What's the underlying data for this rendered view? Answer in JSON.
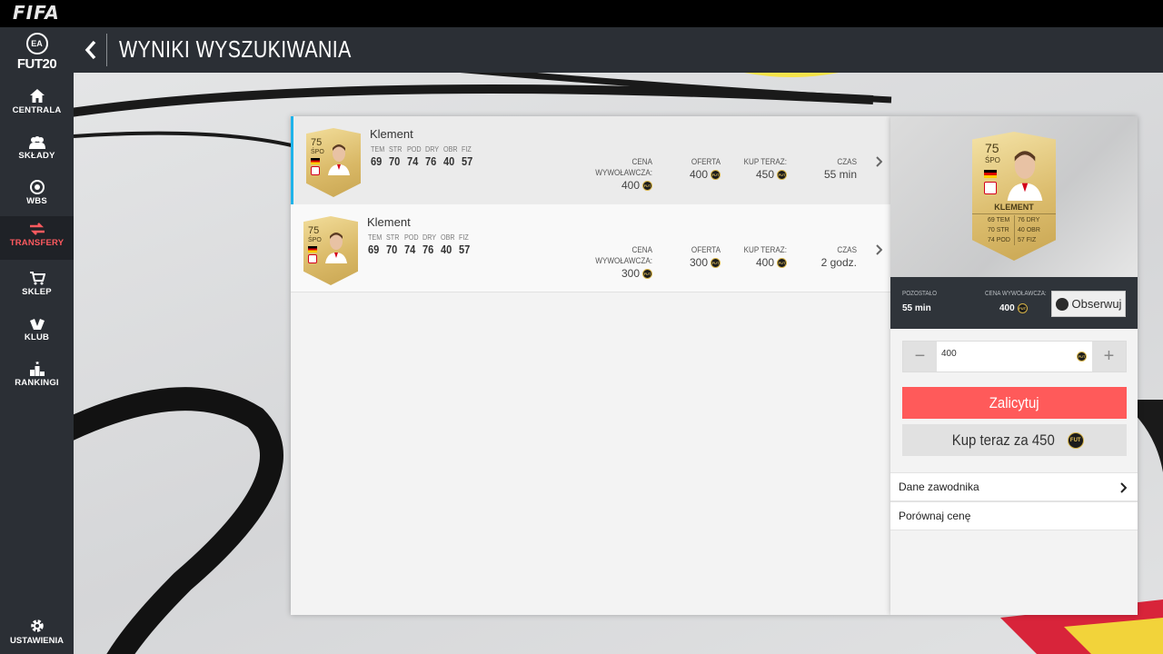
{
  "app": {
    "logo": "FIFA"
  },
  "brand": {
    "ea": "EA",
    "fut": "FUT20"
  },
  "sidebar": {
    "items": [
      {
        "label": "CENTRALA"
      },
      {
        "label": "SKŁADY"
      },
      {
        "label": "WBS"
      },
      {
        "label": "TRANSFERY",
        "active": true
      },
      {
        "label": "SKLEP"
      },
      {
        "label": "KLUB"
      },
      {
        "label": "RANKINGI"
      }
    ],
    "settings_label": "USTAWIENIA"
  },
  "header": {
    "title": "WYNIKI WYSZUKIWANIA"
  },
  "stat_labels": [
    "TEM",
    "STR",
    "POD",
    "DRY",
    "OBR",
    "FIZ"
  ],
  "column_labels": {
    "start_price": "CENA WYWOŁAWCZA:",
    "offer": "OFERTA",
    "buy_now": "KUP TERAZ:",
    "time": "CZAS"
  },
  "coin_text": "FUT",
  "results": [
    {
      "name": "Klement",
      "rating": "75",
      "position": "ŚPO",
      "stats": [
        "69",
        "70",
        "74",
        "76",
        "40",
        "57"
      ],
      "start_price": "400",
      "offer": "400",
      "buy_now": "450",
      "time": "55 min",
      "selected": true
    },
    {
      "name": "Klement",
      "rating": "75",
      "position": "ŚPO",
      "stats": [
        "69",
        "70",
        "74",
        "76",
        "40",
        "57"
      ],
      "start_price": "300",
      "offer": "300",
      "buy_now": "400",
      "time": "2 godz.",
      "selected": false
    }
  ],
  "detail": {
    "card": {
      "rating": "75",
      "position": "ŚPO",
      "name": "KLEMENT",
      "stats_left": [
        "69 TEM",
        "70 STR",
        "74 POD"
      ],
      "stats_right": [
        "76 DRY",
        "40 OBR",
        "57 FIZ"
      ]
    },
    "remaining_label": "POZOSTAŁO",
    "remaining_value": "55 min",
    "start_price_label": "CENA WYWOŁAWCZA:",
    "start_price_value": "400",
    "watch_label": "Obserwuj",
    "bid_value": "400",
    "minus": "−",
    "plus": "+",
    "bid_button": "Zalicytuj",
    "buy_button": "Kup teraz za 450",
    "player_data": "Dane zawodnika",
    "compare_price": "Porównaj cenę"
  },
  "colors": {
    "accent_red": "#ff5a5a",
    "selection_blue": "#1fb3ea",
    "card_gold": "#d9b866",
    "dark_panel": "#2b2f35"
  }
}
